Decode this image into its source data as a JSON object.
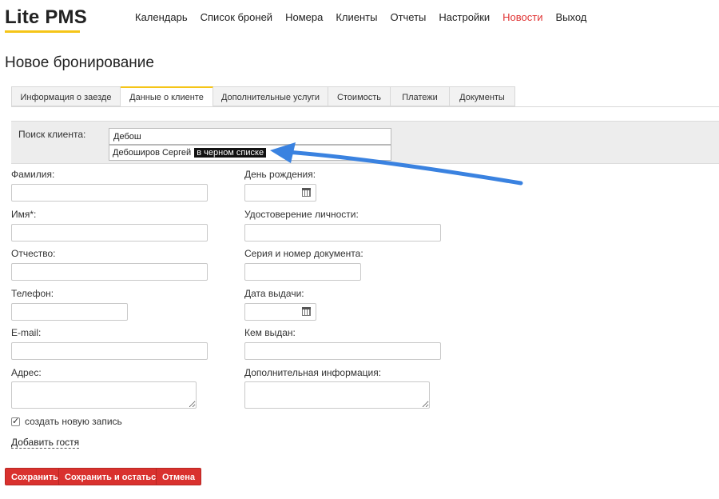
{
  "app": {
    "logo": "Lite PMS",
    "accent_color": "#f5c518",
    "danger_color": "#d9312e"
  },
  "nav": [
    {
      "label": "Календарь",
      "name": "nav-calendar"
    },
    {
      "label": "Список броней",
      "name": "nav-bookings"
    },
    {
      "label": "Номера",
      "name": "nav-rooms"
    },
    {
      "label": "Клиенты",
      "name": "nav-clients"
    },
    {
      "label": "Отчеты",
      "name": "nav-reports"
    },
    {
      "label": "Настройки",
      "name": "nav-settings"
    },
    {
      "label": "Новости",
      "name": "nav-news"
    },
    {
      "label": "Выход",
      "name": "nav-logout"
    }
  ],
  "page": {
    "title": "Новое бронирование"
  },
  "tabs": [
    {
      "label": "Информация о заезде"
    },
    {
      "label": "Данные о клиенте",
      "active": true
    },
    {
      "label": "Дополнительные услуги"
    },
    {
      "label": "Стоимость"
    },
    {
      "label": "Платежи"
    },
    {
      "label": "Документы"
    }
  ],
  "search": {
    "label": "Поиск клиента:",
    "value": "Дебош",
    "suggestion_name": "Дебоширов Сергей",
    "suggestion_badge": "в черном списке"
  },
  "form": {
    "lastname": "Фамилия:",
    "firstname": "Имя*:",
    "middlename": "Отчество:",
    "phone": "Телефон:",
    "email": "E-mail:",
    "address": "Адрес:",
    "birthday": "День рождения:",
    "id_document": "Удостоверение личности:",
    "doc_number": "Серия и номер документа:",
    "issue_date": "Дата выдачи:",
    "issued_by": "Кем выдан:",
    "extra_info": "Дополнительная информация:"
  },
  "create_record": {
    "label": "создать новую запись",
    "checked": true
  },
  "add_guest": "Добавить гостя",
  "buttons": {
    "save": "Сохранить",
    "save_stay": "Сохранить и остаться",
    "cancel": "Отмена"
  }
}
